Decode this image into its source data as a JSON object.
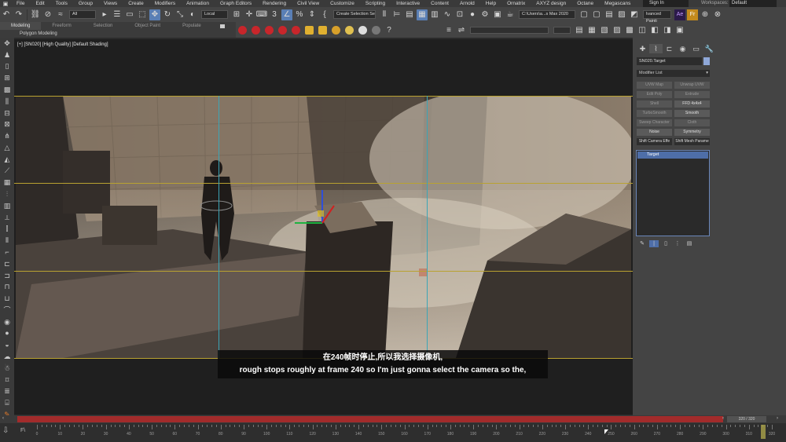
{
  "menubar": {
    "items": [
      "File",
      "Edit",
      "Tools",
      "Group",
      "Views",
      "Create",
      "Modifiers",
      "Animation",
      "Graph Editors",
      "Rendering",
      "Civil View",
      "Customize",
      "Scripting",
      "Interactive",
      "Content",
      "Arnold",
      "Help",
      "Ornatrix",
      "AXYZ design",
      "Octane",
      "Megascans"
    ],
    "signin": "Sign In",
    "workspaces_label": "Workspaces:",
    "workspace_value": "Default"
  },
  "toolbar": {
    "filter_value": "All",
    "coord_value": "Local",
    "selection_set": "Create Selection Se",
    "path_field": "C:\\Users\\a...s Max 2020",
    "render_label": "lvanced Painti"
  },
  "ribbon": {
    "tabs": [
      "Modeling",
      "Freeform",
      "Selection",
      "Object Paint",
      "Populate"
    ],
    "active_tab": "Modeling",
    "subtitle": "Polygon Modeling"
  },
  "viewport": {
    "label": "[+] [SN020] [High Quality] [Default Shading]"
  },
  "command_panel": {
    "object_name": "SN020.Target",
    "modifier_list": "Modifier List",
    "modifiers": [
      {
        "label": "UVW Map",
        "enabled": false
      },
      {
        "label": "Unwrap UVW",
        "enabled": false
      },
      {
        "label": "Edit Poly",
        "enabled": false
      },
      {
        "label": "Extrude",
        "enabled": false
      },
      {
        "label": "Shell",
        "enabled": false
      },
      {
        "label": "FFD 4x4x4",
        "enabled": true
      },
      {
        "label": "TurboSmooth",
        "enabled": false
      },
      {
        "label": "Smooth",
        "enabled": true
      },
      {
        "label": "Sweep Character",
        "enabled": false
      },
      {
        "label": "Cloth",
        "enabled": false
      },
      {
        "label": "Noise",
        "enabled": true
      },
      {
        "label": "Symmetry",
        "enabled": true
      },
      {
        "label": "Shift Camera Effe",
        "enabled": true,
        "dark": true
      },
      {
        "label": "Shift Mesh Parame",
        "enabled": true,
        "dark": true
      }
    ],
    "stack": [
      "Target"
    ]
  },
  "timeline": {
    "slider_text": "320 / 320",
    "ticks": [
      "0",
      "10",
      "20",
      "30",
      "40",
      "50",
      "60",
      "70",
      "80",
      "90",
      "100",
      "110",
      "120",
      "130",
      "140",
      "150",
      "160",
      "170",
      "180",
      "190",
      "200",
      "210",
      "220",
      "230",
      "240",
      "250",
      "260",
      "270",
      "280",
      "290",
      "300",
      "310",
      "320"
    ]
  },
  "subtitles": {
    "line1": "在240帧时停止,所以我选择摄像机,",
    "line2": "rough stops roughly at frame 240 so I'm just gonna select the camera so the,"
  },
  "colors": {
    "accent": "#5a7fb5",
    "timeline_red": "#a22b2b",
    "safe_frame_yellow": "#b9a231",
    "safe_frame_cyan": "#3ba5b6"
  }
}
